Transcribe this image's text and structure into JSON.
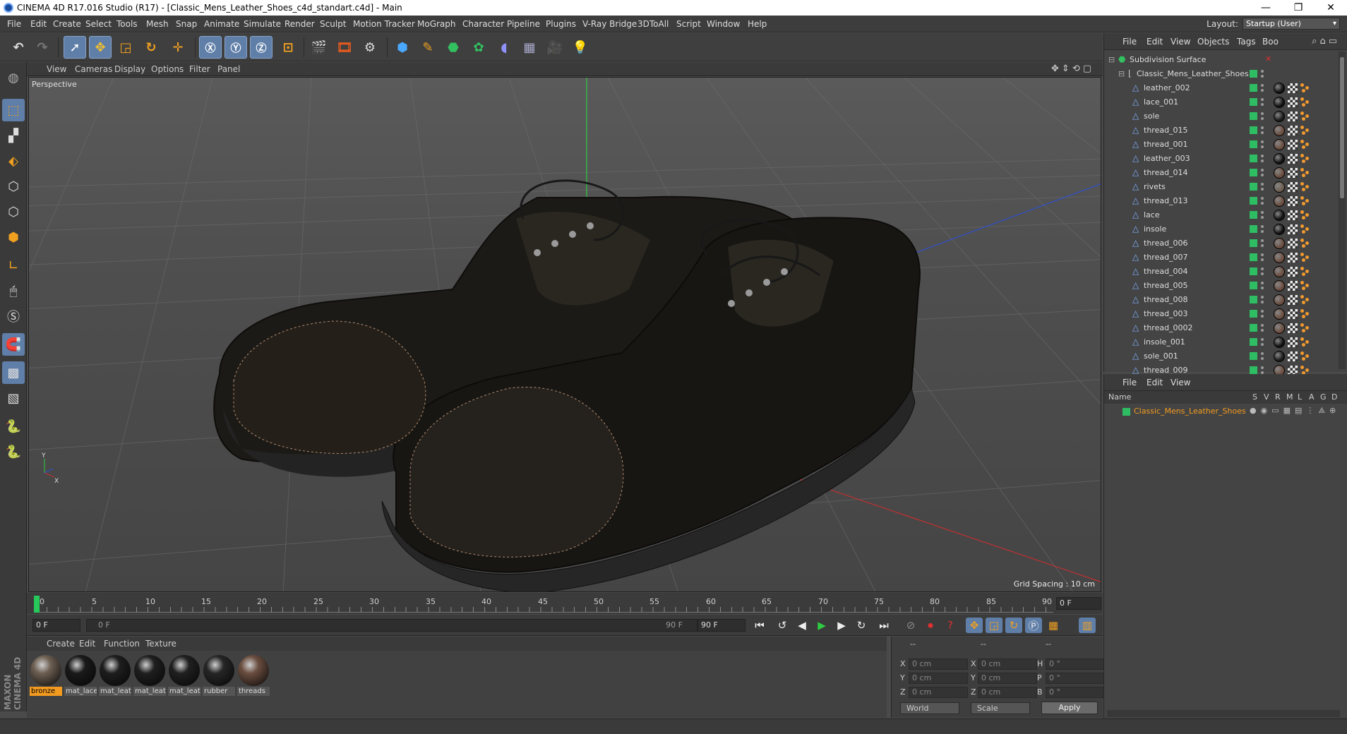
{
  "window": {
    "title": "CINEMA 4D R17.016 Studio (R17) - [Classic_Mens_Leather_Shoes_c4d_standart.c4d] - Main",
    "minimize": "—",
    "restore": "❐",
    "close": "✕"
  },
  "menu": [
    "File",
    "Edit",
    "Create",
    "Select",
    "Tools",
    "Mesh",
    "Snap",
    "Animate",
    "Simulate",
    "Render",
    "Sculpt",
    "Motion Tracker",
    "MoGraph",
    "Character",
    "Pipeline",
    "Plugins",
    "V-Ray Bridge",
    "3DToAll",
    "Script",
    "Window",
    "Help"
  ],
  "layout": {
    "label": "Layout:",
    "value": "Startup (User)"
  },
  "viewport": {
    "menu": [
      "View",
      "Cameras",
      "Display",
      "Options",
      "Filter",
      "Panel"
    ],
    "label": "Perspective",
    "grid_spacing": "Grid Spacing : 10 cm"
  },
  "timeline": {
    "ticks": [
      "0",
      "5",
      "10",
      "15",
      "20",
      "25",
      "30",
      "35",
      "40",
      "45",
      "50",
      "55",
      "60",
      "65",
      "70",
      "75",
      "80",
      "85",
      "90"
    ],
    "current_frame": "0 F",
    "start_field": "0 F",
    "range_start": "0 F",
    "range_end": "90 F",
    "end_field": "90 F"
  },
  "materials": {
    "menu": [
      "Create",
      "Edit",
      "Function",
      "Texture"
    ],
    "items": [
      {
        "name": "bronze",
        "color": "#6d5f52",
        "selected": true
      },
      {
        "name": "mat_lace",
        "color": "#1a1a1a",
        "selected": false
      },
      {
        "name": "mat_leat",
        "color": "#1e1e1e",
        "selected": false
      },
      {
        "name": "mat_leat",
        "color": "#1f1f1f",
        "selected": false
      },
      {
        "name": "mat_leat",
        "color": "#202020",
        "selected": false
      },
      {
        "name": "rubber",
        "color": "#262626",
        "selected": false
      },
      {
        "name": "threads",
        "color": "#6b4e40",
        "selected": false
      }
    ]
  },
  "coords": {
    "headers": [
      "--",
      "--",
      "--"
    ],
    "rows": [
      {
        "a": "X",
        "av": "0 cm",
        "b": "X",
        "bv": "0 cm",
        "c": "H",
        "cv": "0 °"
      },
      {
        "a": "Y",
        "av": "0 cm",
        "b": "Y",
        "bv": "0 cm",
        "c": "P",
        "cv": "0 °"
      },
      {
        "a": "Z",
        "av": "0 cm",
        "b": "Z",
        "bv": "0 cm",
        "c": "B",
        "cv": "0 °"
      }
    ],
    "mode": "World",
    "scale": "Scale",
    "apply": "Apply"
  },
  "objects": {
    "menu": [
      "File",
      "Edit",
      "View",
      "Objects",
      "Tags",
      "Boo"
    ],
    "root": "Subdivision Surface",
    "group": "Classic_Mens_Leather_Shoes",
    "items": [
      {
        "name": "leather_002",
        "tag": "#111"
      },
      {
        "name": "lace_001",
        "tag": "#111"
      },
      {
        "name": "sole",
        "tag": "#1a1a1a"
      },
      {
        "name": "thread_015",
        "tag": "#6b4e40"
      },
      {
        "name": "thread_001",
        "tag": "#6b4e40"
      },
      {
        "name": "leather_003",
        "tag": "#111"
      },
      {
        "name": "thread_014",
        "tag": "#6b4e40"
      },
      {
        "name": "rivets",
        "tag": "#6d5f52"
      },
      {
        "name": "thread_013",
        "tag": "#6b4e40"
      },
      {
        "name": "lace",
        "tag": "#111"
      },
      {
        "name": "insole",
        "tag": "#111"
      },
      {
        "name": "thread_006",
        "tag": "#6b4e40"
      },
      {
        "name": "thread_007",
        "tag": "#6b4e40"
      },
      {
        "name": "thread_004",
        "tag": "#6b4e40"
      },
      {
        "name": "thread_005",
        "tag": "#6b4e40"
      },
      {
        "name": "thread_008",
        "tag": "#6b4e40"
      },
      {
        "name": "thread_003",
        "tag": "#6b4e40"
      },
      {
        "name": "thread_0002",
        "tag": "#6b4e40"
      },
      {
        "name": "insole_001",
        "tag": "#111"
      },
      {
        "name": "sole_001",
        "tag": "#1a1a1a"
      },
      {
        "name": "thread_009",
        "tag": "#6b4e40"
      }
    ]
  },
  "attributes": {
    "menu": [
      "File",
      "Edit",
      "View"
    ],
    "columns": [
      "Name",
      "S",
      "V",
      "R",
      "M",
      "L",
      "A",
      "G",
      "D"
    ],
    "row": "Classic_Mens_Leather_Shoes"
  },
  "brand": "MAXON CINEMA 4D"
}
